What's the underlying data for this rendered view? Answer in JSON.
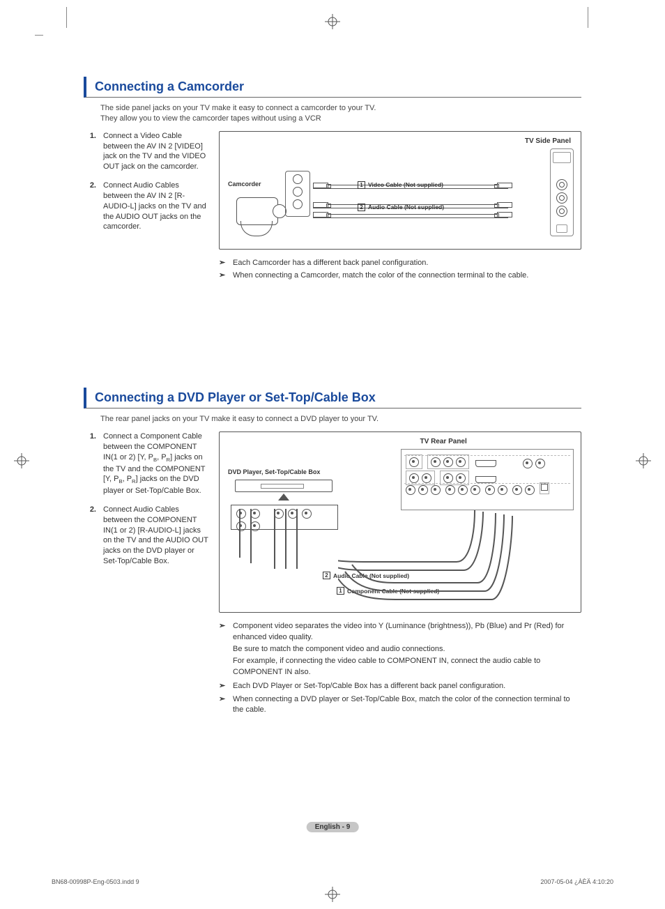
{
  "section1": {
    "heading": "Connecting a Camcorder",
    "lead1": "The side panel jacks on your TV make it easy to connect a camcorder to your TV.",
    "lead2": "They allow you to view the camcorder tapes without using a VCR",
    "step1_num": "1.",
    "step1": "Connect a Video Cable between the AV IN 2 [VIDEO] jack on the TV and the VIDEO OUT jack on the camcorder.",
    "step2_num": "2.",
    "step2": "Connect Audio Cables between the AV IN 2 [R-AUDIO-L]  jacks on the TV and the AUDIO OUT jacks on the camcorder.",
    "diagram": {
      "panel_title": "TV Side Panel",
      "device_label": "Camcorder",
      "badge1": "1",
      "cable1": "Video Cable (Not supplied)",
      "badge2": "2",
      "cable2": "Audio Cable (Not supplied)"
    },
    "note1": "Each Camcorder has a different back panel configuration.",
    "note2": "When connecting a Camcorder, match the color of the connection terminal to the cable."
  },
  "section2": {
    "heading": "Connecting a DVD Player or Set-Top/Cable Box",
    "lead1": "The rear panel jacks on your TV make it easy to connect a DVD player to your TV.",
    "step1_num": "1.",
    "step1_html": "Connect a Component Cable between the COMPONENT IN(1 or 2) [Y, P<sub>B</sub>, P<sub>R</sub>] jacks on the TV and the COMPONENT [Y, P<sub>B</sub>, P<sub>R</sub>]  jacks on the DVD player or Set-Top/Cable Box.",
    "step2_num": "2.",
    "step2": "Connect Audio Cables between the COMPONENT IN(1 or 2) [R-AUDIO-L] jacks on the TV and the AUDIO OUT jacks on the DVD player or Set-Top/Cable Box.",
    "diagram": {
      "panel_title": "TV Rear Panel",
      "device_label": "DVD Player, Set-Top/Cable Box",
      "badge1": "1",
      "cable1": "Component Cable (Not supplied)",
      "badge2": "2",
      "cable2": "Audio Cable (Not supplied)"
    },
    "note1a": "Component video separates the video into Y (Luminance (brightness)), Pb (Blue) and Pr (Red) for enhanced video quality.",
    "note1b": "Be sure to match the component video and audio connections.",
    "note1c": "For example, if connecting the video cable to COMPONENT IN, connect the audio cable to COMPONENT IN also.",
    "note2": "Each DVD Player or Set-Top/Cable Box has a different back panel configuration.",
    "note3": "When connecting a DVD player or Set-Top/Cable Box, match the color of the connection terminal to the cable."
  },
  "footer": {
    "page_label": "English - 9",
    "doc_left": "BN68-00998P-Eng-0503.indd   9",
    "doc_right": "2007-05-04   ¿ÀÈÄ 4:10:20"
  },
  "glyphs": {
    "note_arrow": "➣"
  }
}
